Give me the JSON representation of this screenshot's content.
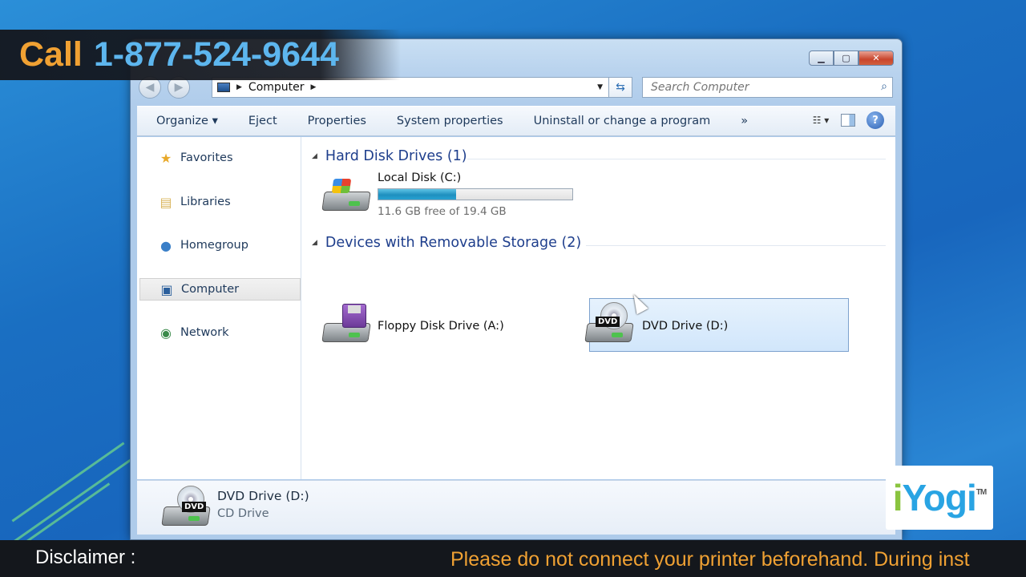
{
  "overlay": {
    "call_label": "Call",
    "phone": "1-877-524-9644",
    "logo_text": "iYogi",
    "logo_tm": "TM",
    "disclaimer_label": "Disclaimer :",
    "disclaimer_text": "Please do not connect your printer beforehand. During inst"
  },
  "window": {
    "controls": {
      "minimize": "▁",
      "maximize": "▢",
      "close": "✕"
    }
  },
  "address": {
    "back": "◀",
    "forward": "▶",
    "path": "Computer",
    "search_placeholder": "Search Computer"
  },
  "toolbar": {
    "organize": "Organize ▾",
    "eject": "Eject",
    "properties": "Properties",
    "system_properties": "System properties",
    "uninstall": "Uninstall or change a program",
    "more": "»",
    "help": "?"
  },
  "sidebar": {
    "items": [
      {
        "label": "Favorites",
        "icon": "star-icon"
      },
      {
        "label": "Libraries",
        "icon": "libraries-icon"
      },
      {
        "label": "Homegroup",
        "icon": "homegroup-icon"
      },
      {
        "label": "Computer",
        "icon": "computer-icon",
        "selected": true
      },
      {
        "label": "Network",
        "icon": "network-icon"
      }
    ]
  },
  "groups": {
    "hard_disks": "Hard Disk Drives (1)",
    "removable": "Devices with Removable Storage (2)"
  },
  "drives": {
    "local": {
      "name": "Local Disk (C:)",
      "free": "11.6 GB free of 19.4 GB",
      "used_fraction": 0.402
    },
    "floppy": {
      "name": "Floppy Disk Drive (A:)"
    },
    "dvd": {
      "name": "DVD Drive (D:)",
      "badge": "DVD"
    }
  },
  "details": {
    "name": "DVD Drive (D:)",
    "type": "CD Drive",
    "badge": "DVD"
  },
  "colors": {
    "accent_orange": "#f0a133",
    "accent_blue": "#5db6ee",
    "group_header": "#1e3e8c",
    "disk_fill": "#1e8fbf"
  }
}
